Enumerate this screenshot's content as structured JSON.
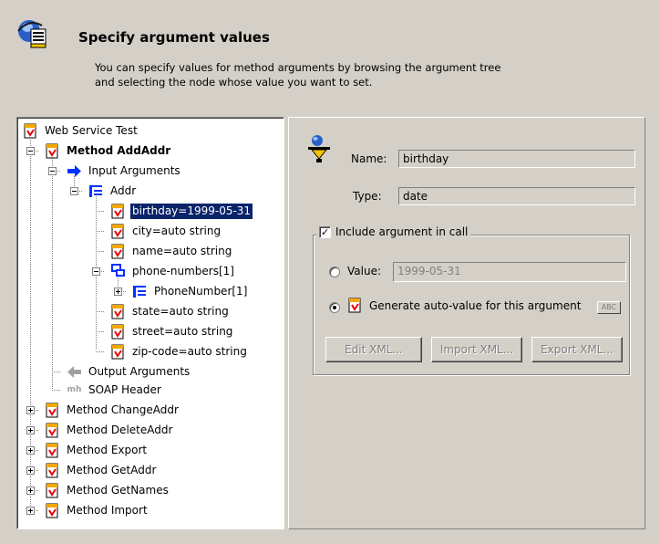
{
  "header": {
    "title": "Specify argument values",
    "description_line1": "You can specify values for method arguments by browsing the argument tree",
    "description_line2": "and selecting the node whose value you want to set."
  },
  "tree": {
    "nodes": [
      {
        "label": "Web Service Test",
        "icon": "web-service-icon"
      },
      {
        "label": "Method AddAddr",
        "icon": "method-icon"
      },
      {
        "label": "Input Arguments",
        "icon": "input-arrow-icon"
      },
      {
        "label": "Addr",
        "icon": "struct-icon"
      },
      {
        "label": "birthday=1999-05-31",
        "icon": "argument-icon"
      },
      {
        "label": "city=auto string",
        "icon": "argument-icon"
      },
      {
        "label": "name=auto string",
        "icon": "argument-icon"
      },
      {
        "label": "phone-numbers[1]",
        "icon": "array-icon"
      },
      {
        "label": "PhoneNumber[1]",
        "icon": "struct-icon"
      },
      {
        "label": "state=auto string",
        "icon": "argument-icon"
      },
      {
        "label": "street=auto string",
        "icon": "argument-icon"
      },
      {
        "label": "zip-code=auto string",
        "icon": "argument-icon"
      },
      {
        "label": "Output Arguments",
        "icon": "output-arrow-icon"
      },
      {
        "label": "SOAP Header",
        "icon": "soap-header-icon"
      },
      {
        "label": "Method ChangeAddr",
        "icon": "method-icon"
      },
      {
        "label": "Method DeleteAddr",
        "icon": "method-icon"
      },
      {
        "label": "Method Export",
        "icon": "method-icon"
      },
      {
        "label": "Method GetAddr",
        "icon": "method-icon"
      },
      {
        "label": "Method GetNames",
        "icon": "method-icon"
      },
      {
        "label": "Method Import",
        "icon": "method-icon"
      }
    ],
    "soap_header_prefix": "mh"
  },
  "properties": {
    "name_label": "Name:",
    "name_value": "birthday",
    "type_label": "Type:",
    "type_value": "date",
    "include_label": "Include argument in call",
    "include_checked": true,
    "value_label": "Value:",
    "value_value": "1999-05-31",
    "value_button": "ABC",
    "generate_label": "Generate auto-value for this argument",
    "selected_option": "generate",
    "buttons": {
      "edit_xml": "Edit XML...",
      "import_xml": "Import XML...",
      "export_xml": "Export XML..."
    }
  },
  "colors": {
    "background": "#d4d0c8",
    "selection": "#0a246a",
    "arrow_blue": "#0033ff"
  }
}
